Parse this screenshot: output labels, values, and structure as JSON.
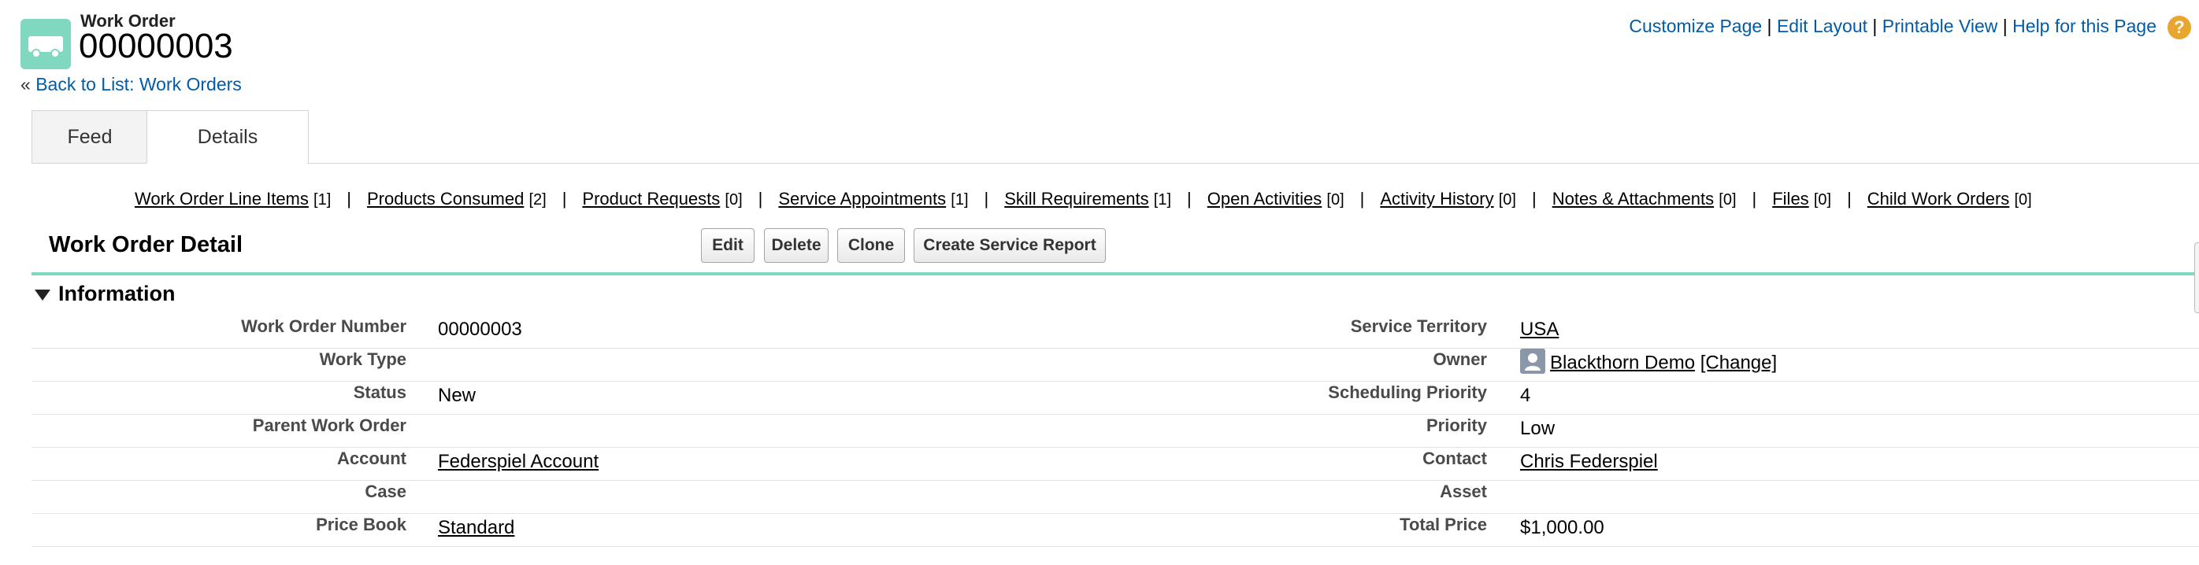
{
  "header": {
    "icon": "truck-icon",
    "object_type": "Work Order",
    "record_name": "00000003",
    "back_prefix": "« ",
    "back_link": "Back to List: Work Orders"
  },
  "top_links": {
    "customize": "Customize Page",
    "edit_layout": "Edit Layout",
    "printable": "Printable View",
    "help": "Help for this Page",
    "separator": " | ",
    "help_icon": "?"
  },
  "tabs": [
    "Feed",
    "Details"
  ],
  "related_lists": [
    {
      "label": "Work Order Line Items",
      "count": "[1]"
    },
    {
      "label": "Products Consumed",
      "count": "[2]"
    },
    {
      "label": "Product Requests",
      "count": "[0]"
    },
    {
      "label": "Service Appointments",
      "count": "[1]"
    },
    {
      "label": "Skill Requirements",
      "count": "[1]"
    },
    {
      "label": "Open Activities",
      "count": "[0]"
    },
    {
      "label": "Activity History",
      "count": "[0]"
    },
    {
      "label": "Notes & Attachments",
      "count": "[0]"
    },
    {
      "label": "Files",
      "count": "[0]"
    },
    {
      "label": "Child Work Orders",
      "count": "[0]"
    }
  ],
  "detail": {
    "title": "Work Order Detail",
    "buttons": [
      "Edit",
      "Delete",
      "Clone",
      "Create Service Report"
    ],
    "section": "Information"
  },
  "fields_left": [
    {
      "label": "Work Order Number",
      "value": "00000003",
      "link": false
    },
    {
      "label": "Work Type",
      "value": "",
      "link": false
    },
    {
      "label": "Status",
      "value": "New",
      "link": false
    },
    {
      "label": "Parent Work Order",
      "value": "",
      "link": false
    },
    {
      "label": "Account",
      "value": "Federspiel Account",
      "link": true
    },
    {
      "label": "Case",
      "value": "",
      "link": false
    },
    {
      "label": "Price Book",
      "value": "Standard",
      "link": true
    }
  ],
  "fields_right": [
    {
      "label": "Service Territory",
      "value": "USA",
      "link": true
    },
    {
      "label": "Owner",
      "value": "Blackthorn Demo",
      "link": true,
      "extra": "[Change]"
    },
    {
      "label": "Scheduling Priority",
      "value": "4",
      "link": false
    },
    {
      "label": "Priority",
      "value": "Low",
      "link": false
    },
    {
      "label": "Contact",
      "value": "Chris Federspiel",
      "link": true
    },
    {
      "label": "Asset",
      "value": "",
      "link": false
    },
    {
      "label": "Total Price",
      "value": "$1,000.00",
      "link": false
    }
  ],
  "colors": {
    "accent": "#7fd8bf",
    "link": "#015ba7",
    "help": "#e8a530"
  }
}
